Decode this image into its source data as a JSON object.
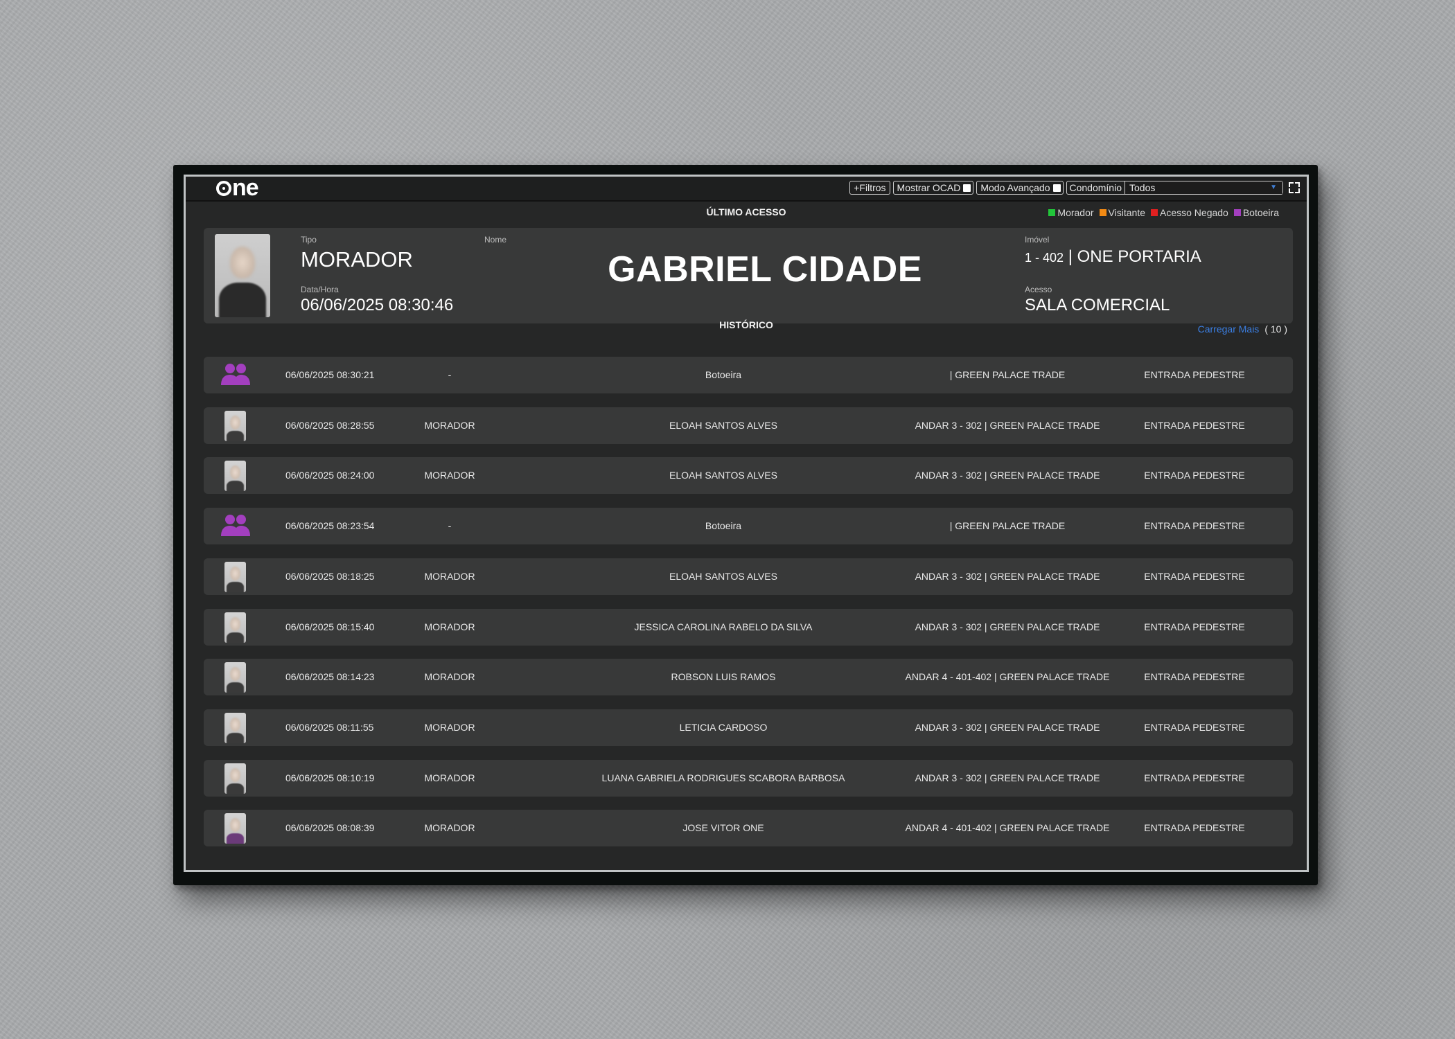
{
  "app": {
    "logo": "one"
  },
  "toolbar": {
    "filters_label": "+Filtros",
    "show_ocad_label": "Mostrar OCAD",
    "advanced_mode_label": "Modo Avançado",
    "condo_label": "Condomínio",
    "condo_value": "Todos"
  },
  "last_access": {
    "section_title": "ÚLTIMO ACESSO",
    "type_label": "Tipo",
    "type_value": "MORADOR",
    "datetime_label": "Data/Hora",
    "datetime_value": "06/06/2025 08:30:46",
    "name_label": "Nome",
    "name_value": "GABRIEL CIDADE",
    "property_label": "Imóvel",
    "property_unit": "1 - 402",
    "property_name": "| ONE PORTARIA",
    "access_label": "Acesso",
    "access_value": "SALA COMERCIAL"
  },
  "legend": [
    {
      "label": "Morador",
      "color": "#22c53a"
    },
    {
      "label": "Visitante",
      "color": "#f28a14"
    },
    {
      "label": "Acesso Negado",
      "color": "#e02020"
    },
    {
      "label": "Botoeira",
      "color": "#a33fbf"
    }
  ],
  "history": {
    "section_title": "HISTÓRICO",
    "load_more": "Carregar Mais",
    "count": "( 10 )",
    "rows": [
      {
        "icon": "group-icon",
        "datetime": "06/06/2025 08:30:21",
        "type": "-",
        "name": "Botoeira",
        "location": "| GREEN PALACE TRADE",
        "access": "ENTRADA PEDESTRE"
      },
      {
        "icon": "photo",
        "datetime": "06/06/2025 08:28:55",
        "type": "MORADOR",
        "name": "ELOAH SANTOS ALVES",
        "location": "ANDAR 3 - 302 | GREEN PALACE TRADE",
        "access": "ENTRADA PEDESTRE"
      },
      {
        "icon": "photo",
        "datetime": "06/06/2025 08:24:00",
        "type": "MORADOR",
        "name": "ELOAH SANTOS ALVES",
        "location": "ANDAR 3 - 302 | GREEN PALACE TRADE",
        "access": "ENTRADA PEDESTRE"
      },
      {
        "icon": "group-icon",
        "datetime": "06/06/2025 08:23:54",
        "type": "-",
        "name": "Botoeira",
        "location": "| GREEN PALACE TRADE",
        "access": "ENTRADA PEDESTRE"
      },
      {
        "icon": "photo",
        "datetime": "06/06/2025 08:18:25",
        "type": "MORADOR",
        "name": "ELOAH SANTOS ALVES",
        "location": "ANDAR 3 - 302 | GREEN PALACE TRADE",
        "access": "ENTRADA PEDESTRE"
      },
      {
        "icon": "photo",
        "datetime": "06/06/2025 08:15:40",
        "type": "MORADOR",
        "name": "JESSICA CAROLINA RABELO DA SILVA",
        "location": "ANDAR 3 - 302 | GREEN PALACE TRADE",
        "access": "ENTRADA PEDESTRE"
      },
      {
        "icon": "photo",
        "datetime": "06/06/2025 08:14:23",
        "type": "MORADOR",
        "name": "ROBSON LUIS RAMOS",
        "location": "ANDAR 4 - 401-402 | GREEN PALACE TRADE",
        "access": "ENTRADA PEDESTRE"
      },
      {
        "icon": "photo",
        "datetime": "06/06/2025 08:11:55",
        "type": "MORADOR",
        "name": "LETICIA CARDOSO",
        "location": "ANDAR 3 - 302 | GREEN PALACE TRADE",
        "access": "ENTRADA PEDESTRE"
      },
      {
        "icon": "photo",
        "datetime": "06/06/2025 08:10:19",
        "type": "MORADOR",
        "name": "LUANA GABRIELA RODRIGUES SCABORA BARBOSA",
        "location": "ANDAR 3 - 302 | GREEN PALACE TRADE",
        "access": "ENTRADA PEDESTRE"
      },
      {
        "icon": "photo",
        "datetime": "06/06/2025 08:08:39",
        "type": "MORADOR",
        "name": "JOSE VITOR ONE",
        "location": "ANDAR 4 - 401-402 | GREEN PALACE TRADE",
        "access": "ENTRADA PEDESTRE"
      }
    ]
  }
}
